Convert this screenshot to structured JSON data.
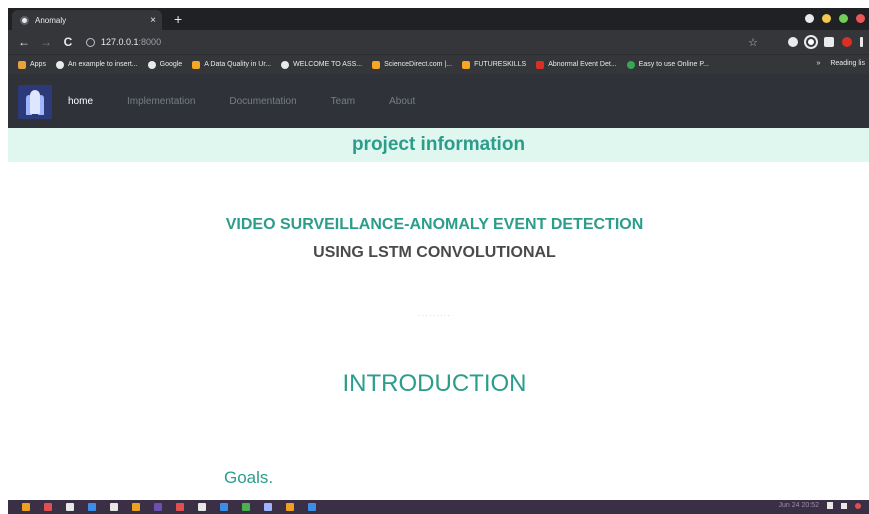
{
  "browser": {
    "tab_title": "Anomaly",
    "tab_close": "×",
    "new_tab": "+",
    "url_host": "127.0.0.1",
    "url_port": ":8000",
    "back": "←",
    "forward": "→",
    "reload": "C",
    "star": "☆",
    "bookmarks": [
      {
        "label": "Apps",
        "icon": "apps-grid-icon",
        "color": "#e8a33d"
      },
      {
        "label": "An example to insert...",
        "icon": "globe-icon",
        "color": "#e8eaed"
      },
      {
        "label": "Google",
        "icon": "google-icon",
        "color": "#e8eaed"
      },
      {
        "label": "A Data Quality in Ur...",
        "icon": "e-logo-icon",
        "color": "#f5a623"
      },
      {
        "label": "WELCOME TO ASS...",
        "icon": "globe-icon",
        "color": "#e8eaed"
      },
      {
        "label": "ScienceDirect.com |...",
        "icon": "e-logo-icon",
        "color": "#f5a623"
      },
      {
        "label": "FUTURESKILLS",
        "icon": "chevron-right-icon",
        "color": "#f5a623"
      },
      {
        "label": "Abnormal Event Det...",
        "icon": "pdf-icon",
        "color": "#d93025"
      },
      {
        "label": "Easy to use Online P...",
        "icon": "circle-icon",
        "color": "#34a853"
      }
    ],
    "bookmarks_more": "»",
    "reading_list": "Reading lis"
  },
  "site": {
    "nav": [
      {
        "label": "home",
        "active": true
      },
      {
        "label": "Implementation",
        "active": false
      },
      {
        "label": "Documentation",
        "active": false
      },
      {
        "label": "Team",
        "active": false
      },
      {
        "label": "About",
        "active": false
      }
    ],
    "band_title": "project information",
    "title_line1": "VIDEO SURVEILLANCE-ANOMALY EVENT DETECTION",
    "title_line2": "USING LSTM CONVOLUTIONAL",
    "divider": "·········",
    "intro_heading": "INTRODUCTION",
    "goals_heading": "Goals."
  },
  "taskbar": {
    "clock": "Jun 24 20:52",
    "icon_colors": [
      "#f0a020",
      "#e05050",
      "#e8e8e8",
      "#3a8ee6",
      "#e8e8e8",
      "#f0a020",
      "#6c4fb0",
      "#e05050",
      "#e8e8e8",
      "#3a8ee6",
      "#4caf50",
      "#9fb4ff",
      "#f0a020",
      "#3a8ee6"
    ]
  }
}
